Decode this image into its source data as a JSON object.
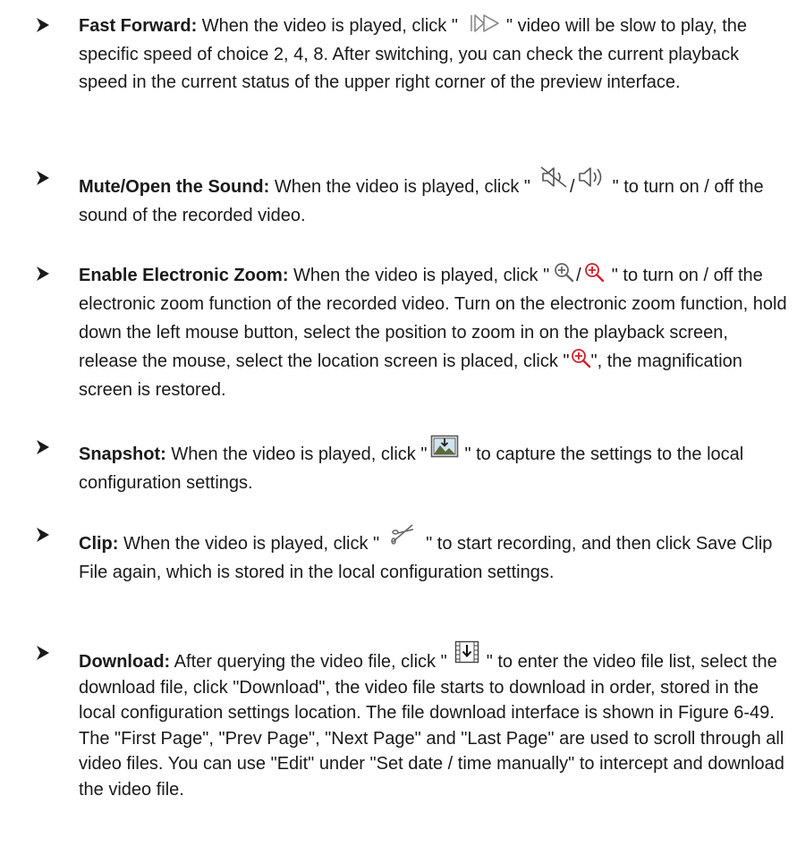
{
  "items": [
    {
      "id": "fast-forward",
      "term": "Fast Forward:",
      "before": " When the video is played, click \"",
      "icon": "fast-forward-icon",
      "after": "\" video will be slow to play, the specific speed of choice 2, 4, 8. After switching, you can check the current playback speed in the current status of the upper right corner of the preview interface."
    },
    {
      "id": "mute",
      "term": "Mute/Open the Sound:",
      "before": " When the video is played, click \"",
      "icon": "mute-icon",
      "icon_separator": "/",
      "icon2": "sound-on-icon",
      "after": "\" to turn on / off the sound of the recorded video."
    },
    {
      "id": "zoom",
      "term": "Enable Electronic Zoom:",
      "before": " When the video is played, click \"",
      "icon": "zoom-in-icon",
      "icon_separator": "/",
      "icon2": "zoom-in-active-icon",
      "after": "\" to turn on / off the electronic zoom function of the recorded video. Turn on the electronic zoom function, hold down the left mouse button, select the position to zoom in on the playback screen, release the mouse, select the location screen is placed, click \"",
      "icon3": "zoom-in-active-icon",
      "after2": "\", the magnification screen is restored."
    },
    {
      "id": "snapshot",
      "term": "Snapshot:",
      "before": " When the video is played, click \"",
      "icon": "snapshot-icon",
      "after": "\" to capture the settings to the local configuration settings."
    },
    {
      "id": "clip",
      "term": "Clip:",
      "before": " When the video is played, click \"",
      "icon": "scissors-icon",
      "after": "\" to start recording, and then click Save Clip File again, which is stored in the local configuration settings."
    },
    {
      "id": "download",
      "term": "Download:",
      "before": " After querying the video file, click \"",
      "icon": "download-icon",
      "after": "\" to enter the video file list, select the download file, click \"Download\", the video file starts to download in order, stored in the local configuration settings location. The file download interface is shown in Figure 6-49. The \"First Page\", \"Prev Page\", \"Next Page\" and \"Last Page\" are used to scroll through all video files. You can use \"Edit\" under \"Set date / time manually\" to intercept and download the video file."
    }
  ],
  "colors": {
    "text": "#1a1a1a",
    "icon_gray": "#8a8a8a",
    "icon_red": "#d0202a"
  }
}
